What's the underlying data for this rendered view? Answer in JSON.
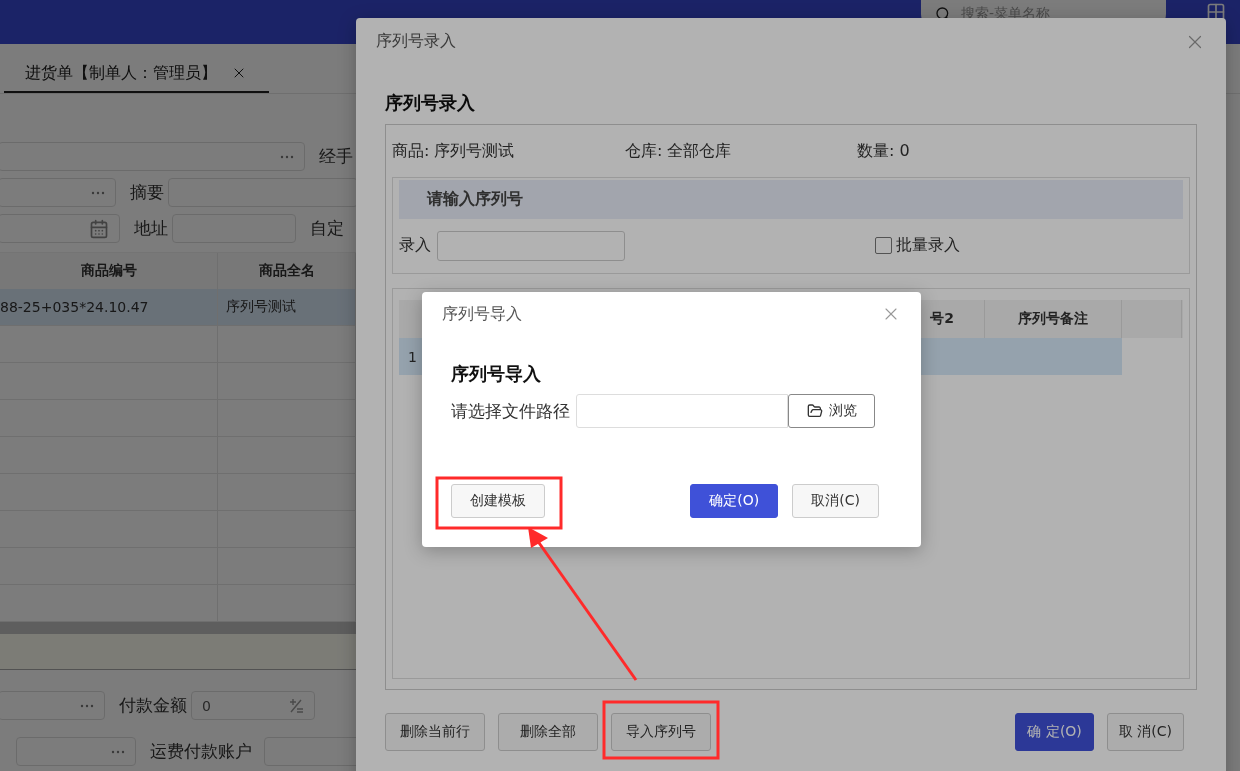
{
  "app": {
    "search_placeholder": "搜索-菜单名称"
  },
  "document_tab": {
    "label": "进货单【制单人：管理员】",
    "selected": true
  },
  "header_form": {
    "handler_label": "经手",
    "summary_label": "摘要",
    "address_label": "地址",
    "custom_label": "自定"
  },
  "goods_table": {
    "columns": [
      "商品编号",
      "商品全名"
    ],
    "rows": [
      {
        "cells": [
          "88-25+035*24.10.47",
          "序列号测试"
        ],
        "selected": true
      }
    ]
  },
  "footer_form": {
    "payment_label": "付款金额",
    "payment_value": "0",
    "freight_account_label": "运费付款账户"
  },
  "serial_dialog": {
    "title": "序列号录入",
    "heading": "序列号录入",
    "info": [
      "商品: 序列号测试",
      "仓库: 全部仓库",
      "数量: 0"
    ],
    "input_section": {
      "title": "请输入序列号",
      "entry_label": "录入",
      "batch": {
        "label": "批量录入",
        "checked": false
      }
    },
    "table": {
      "columns": [
        "号2",
        "序列号备注"
      ],
      "rows": [
        {
          "line": "1",
          "selected": true
        }
      ]
    },
    "left_buttons": [
      {
        "label": "删除当前行",
        "kind": "default"
      },
      {
        "label": "删除全部",
        "kind": "default"
      },
      {
        "label": "导入序列号",
        "kind": "default"
      }
    ],
    "right_buttons": [
      {
        "label": "确 定(O)",
        "kind": "primary"
      },
      {
        "label": "取 消(C)",
        "kind": "default"
      }
    ]
  },
  "import_dialog": {
    "title": "序列号导入",
    "heading": "序列号导入",
    "path_label": "请选择文件路径",
    "browse_label": "浏览",
    "left_buttons": [
      {
        "label": "创建模板",
        "kind": "default"
      }
    ],
    "right_buttons": [
      {
        "label": "确定(O)",
        "kind": "primary"
      },
      {
        "label": "取消(C)",
        "kind": "default"
      }
    ]
  }
}
